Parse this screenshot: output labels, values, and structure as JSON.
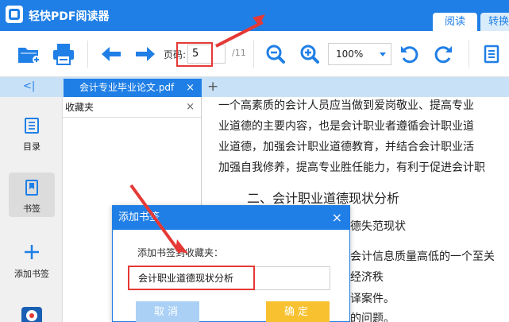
{
  "titlebar": {
    "app_title": "轻快PDF阅读器",
    "tabs": [
      {
        "label": "阅读",
        "active": true
      },
      {
        "label": "转换",
        "active": false
      }
    ]
  },
  "toolbar": {
    "page_label": "页码:",
    "page_value": "5",
    "page_total": "/11",
    "zoom_value": "100%",
    "icons": [
      "open-folder-icon",
      "print-icon",
      "prev-page-icon",
      "next-page-icon",
      "zoom-out-icon",
      "zoom-in-icon",
      "rotate-left-icon",
      "rotate-right-icon",
      "document-view-icon"
    ]
  },
  "tabbar": {
    "collapse_label": "<|",
    "doc_tab_label": "会计专业毕业论文.pdf",
    "close_label": "×",
    "add_label": "+"
  },
  "sidebar": {
    "items": [
      {
        "label": "目录",
        "icon": "outline-icon"
      },
      {
        "label": "书签",
        "icon": "bookmark-icon",
        "active": true
      },
      {
        "label": "添加书签",
        "icon": "add-bookmark-icon"
      }
    ]
  },
  "favorites_panel": {
    "title": "收藏夹",
    "close_label": "×"
  },
  "document": {
    "lines": [
      "一个高素质的会计人员应当做到爱岗敬业、提高专业",
      "业道德的主要内容，也是会计职业者遵循会计职业道",
      "业道德，加强会计职业道德教育，并结合会计职业活",
      "加强自我修养，提高专业胜任能力，有利于促进会计职",
      "二、会计职业道德现状分析",
      "德失范现状",
      "会计信息质量高低的一个至关",
      "经济秩",
      "译案件。",
      "的问题。"
    ]
  },
  "dialog": {
    "title": "添加书签",
    "close_label": "×",
    "prompt": "添加书签到收藏夹：",
    "input_value": "会计职业道德现状分析",
    "cancel_label": "取消",
    "ok_label": "确定"
  },
  "colors": {
    "accent": "#1f7fe6",
    "highlight_red": "#e53935",
    "ok_yellow": "#f8c12f",
    "cancel_light_blue": "#aad0f5"
  }
}
